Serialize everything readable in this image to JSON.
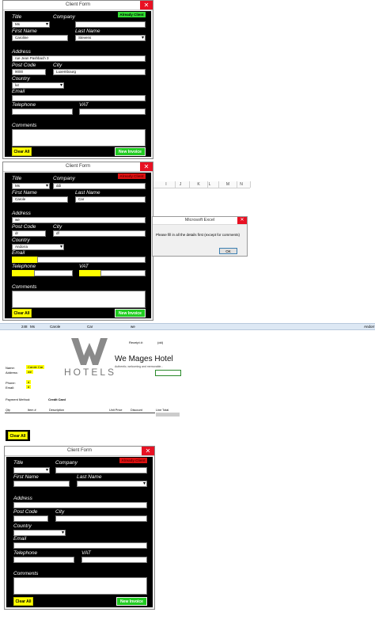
{
  "forms": [
    {
      "title": "Client Form",
      "badge": {
        "text": "Already Client",
        "color": "#33dd33"
      },
      "labels": {
        "title": "Title",
        "company": "Company",
        "first_name": "First Name",
        "last_name": "Last Name",
        "address": "Address",
        "post_code": "Post Code",
        "city": "City",
        "country": "Country",
        "email": "Email",
        "telephone": "Telephone",
        "vat": "VAT",
        "comments": "Comments"
      },
      "values": {
        "title": "Ms",
        "company": "",
        "first_name": "Caroline",
        "last_name": "Stevens",
        "address": "rue Jean Pashbach 3",
        "post_code": "9000",
        "city": "Luxembourg",
        "country": "lut",
        "email": "",
        "telephone": "",
        "vat": "",
        "comments": ""
      },
      "buttons": {
        "clear": "Clear All",
        "new_invoice": "New Invoice"
      }
    },
    {
      "title": "Client Form",
      "badge": {
        "text": "Already Client",
        "color": "#dd1111"
      },
      "labels": {
        "title": "Title",
        "company": "Company",
        "first_name": "First Name",
        "last_name": "Last Name",
        "address": "Address",
        "post_code": "Post Code",
        "city": "City",
        "country": "Country",
        "email": "Email",
        "telephone": "Telephone",
        "vat": "VAT",
        "comments": "Comments"
      },
      "values": {
        "title": "Ms",
        "company": "ddi",
        "first_name": "Carole",
        "last_name": "Car",
        "address": "we",
        "post_code": "dr",
        "city": "df",
        "country": "Andorra",
        "email": "",
        "telephone": "",
        "vat": "",
        "comments": ""
      },
      "buttons": {
        "clear": "Clear All",
        "new_invoice": "New Invoice"
      }
    },
    {
      "title": "Client Form",
      "badge": {
        "text": "Already Client",
        "color": "#dd1111"
      },
      "labels": {
        "title": "Title",
        "company": "Company",
        "first_name": "First Name",
        "last_name": "Last Name",
        "address": "Address",
        "post_code": "Post Code",
        "city": "City",
        "country": "Country",
        "email": "Email",
        "telephone": "Telephone",
        "vat": "VAT",
        "comments": "Comments"
      },
      "values": {
        "title": "",
        "company": "",
        "first_name": "",
        "last_name": "",
        "address": "",
        "post_code": "",
        "city": "",
        "country": "",
        "email": "",
        "telephone": "",
        "vat": "",
        "comments": ""
      },
      "buttons": {
        "clear": "Clear All",
        "new_invoice": "New Invoice"
      }
    }
  ],
  "excel": {
    "columns": [
      "I",
      "J",
      "K",
      "L",
      "M",
      "N"
    ],
    "row": [
      "248",
      "Ms",
      "Carole",
      "Car",
      "we",
      "Andorr"
    ],
    "dialog": {
      "title": "Microsoft Excel",
      "message": "Please fill in all the details first (except for comments)",
      "ok": "OK"
    }
  },
  "invoice": {
    "receipt_label": "Receipt #:",
    "receipt_value": "(dd)",
    "hotel_brand": "HOTELS",
    "hotel_name": "We Mages Hotel",
    "tagline": "Authentic, welcoming and memorable...",
    "name_label": "Name:",
    "name_value": "Carole Car",
    "address_label": "Address:",
    "address_value": "we",
    "phone_label": "Phone:",
    "phone_value": "d",
    "email_label": "Email:",
    "email_value": "d",
    "payment_label": "Payment Method:",
    "payment_value": "Credit Card",
    "columns": [
      "Qty",
      "Item #",
      "Description",
      "Unit Price",
      "Discount",
      "Line Total"
    ],
    "clear_button": "Clear All"
  },
  "colors": {
    "form_bg": "#000000",
    "highlight": "#ffff00",
    "green_button": "#22cc22",
    "close_red": "#e81123"
  }
}
